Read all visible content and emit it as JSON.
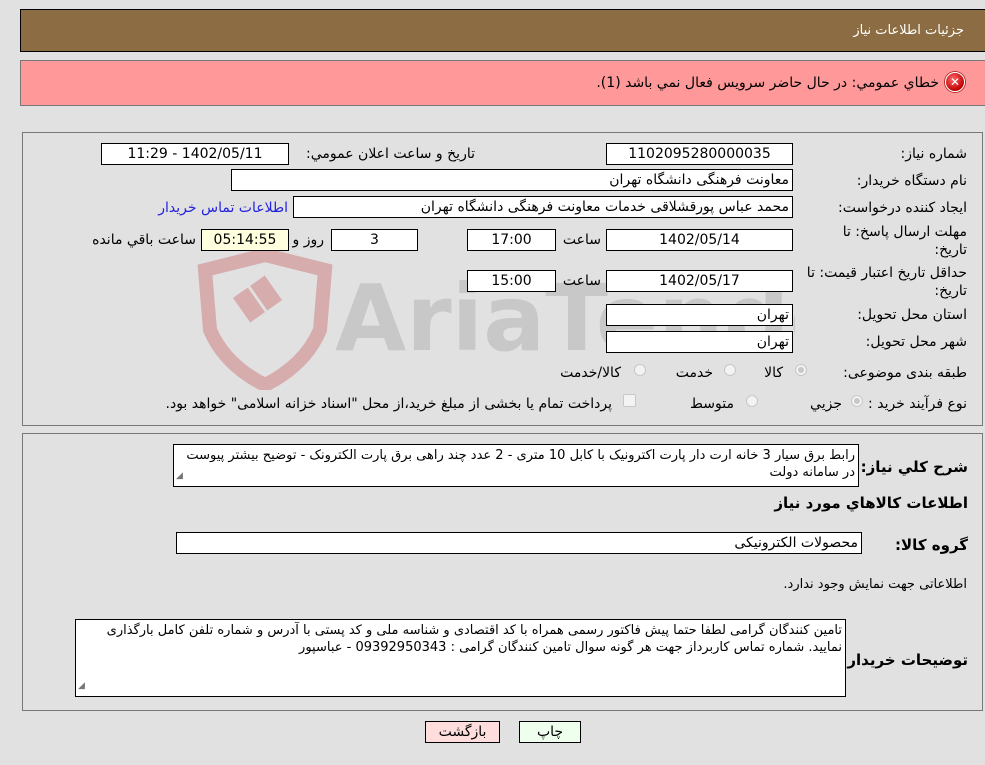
{
  "header": {
    "title": "جزئيات اطلاعات نياز"
  },
  "error": {
    "icon": "error-icon",
    "message": "خطاي عمومي: در حال حاضر سرويس فعال نمي باشد (1)."
  },
  "form": {
    "need_number": {
      "label": "شماره نياز:",
      "value": "1102095280000035"
    },
    "announce_datetime": {
      "label": "تاريخ و ساعت اعلان عمومي:",
      "value": "1402/05/11 - 11:29"
    },
    "buyer_org": {
      "label": "نام دستگاه خريدار:",
      "value": "معاونت فرهنگی دانشگاه تهران"
    },
    "creator": {
      "label": "ايجاد کننده درخواست:",
      "value": "محمد عباس پورقشلاقی خدمات معاونت فرهنگی دانشگاه تهران",
      "contact_link": "اطلاعات تماس خريدار"
    },
    "response_deadline": {
      "label": "مهلت ارسال پاسخ: تا تاريخ:",
      "date": "1402/05/14",
      "time_label": "ساعت",
      "time": "17:00",
      "days": "3",
      "days_label": "روز و",
      "remaining": "05:14:55",
      "remaining_label": "ساعت باقي مانده"
    },
    "price_validity": {
      "label": "حداقل تاريخ اعتبار قيمت: تا تاريخ:",
      "date": "1402/05/17",
      "time_label": "ساعت",
      "time": "15:00"
    },
    "delivery_province": {
      "label": "استان محل تحويل:",
      "value": "تهران"
    },
    "delivery_city": {
      "label": "شهر محل تحويل:",
      "value": "تهران"
    },
    "category": {
      "label": "طبقه بندی موضوعی:",
      "options": [
        {
          "label": "کالا",
          "checked": true
        },
        {
          "label": "خدمت",
          "checked": false
        },
        {
          "label": "کالا/خدمت",
          "checked": false
        }
      ]
    },
    "purchase_process": {
      "label": "نوع فرآيند خريد :",
      "options": [
        {
          "label": "جزيي",
          "checked": true
        },
        {
          "label": "متوسط",
          "checked": false
        }
      ],
      "treasury_checkbox": {
        "label": "پرداخت تمام يا بخشی از مبلغ خريد،از محل \"اسناد خزانه اسلامی\" خواهد بود.",
        "checked": false
      }
    }
  },
  "details": {
    "description_label": "شرح کلي نياز:",
    "description": "رابط برق سیار 3 خانه ارت دار پارت اکترونیک با کابل 10 متری - 2 عدد چند راهی برق پارت الکترونک - توضیح بیشتر پیوست در سامانه دولت",
    "goods_info_title": "اطلاعات کالاهاي مورد نياز",
    "goods_group_label": "گروه کالا:",
    "goods_group_value": "محصولات الکترونیکی",
    "no_data_text": "اطلاعاتی جهت نمايش وجود ندارد.",
    "buyer_notes_label": "توضيحات خريدار:",
    "buyer_notes": "تامین کنندگان گرامی لطفا حتما پیش فاکتور رسمی همراه با کد اقتصادی و شناسه ملی و کد پستی با آدرس و شماره تلفن کامل بارگذاری نمایید. شماره تماس کاربرداز جهت هر گونه سوال تامین کنندگان گرامی : 09392950343 - عباسپور"
  },
  "buttons": {
    "print": "چاپ",
    "back": "بازگشت"
  },
  "watermark": {
    "text": "AriaTender.neT"
  }
}
